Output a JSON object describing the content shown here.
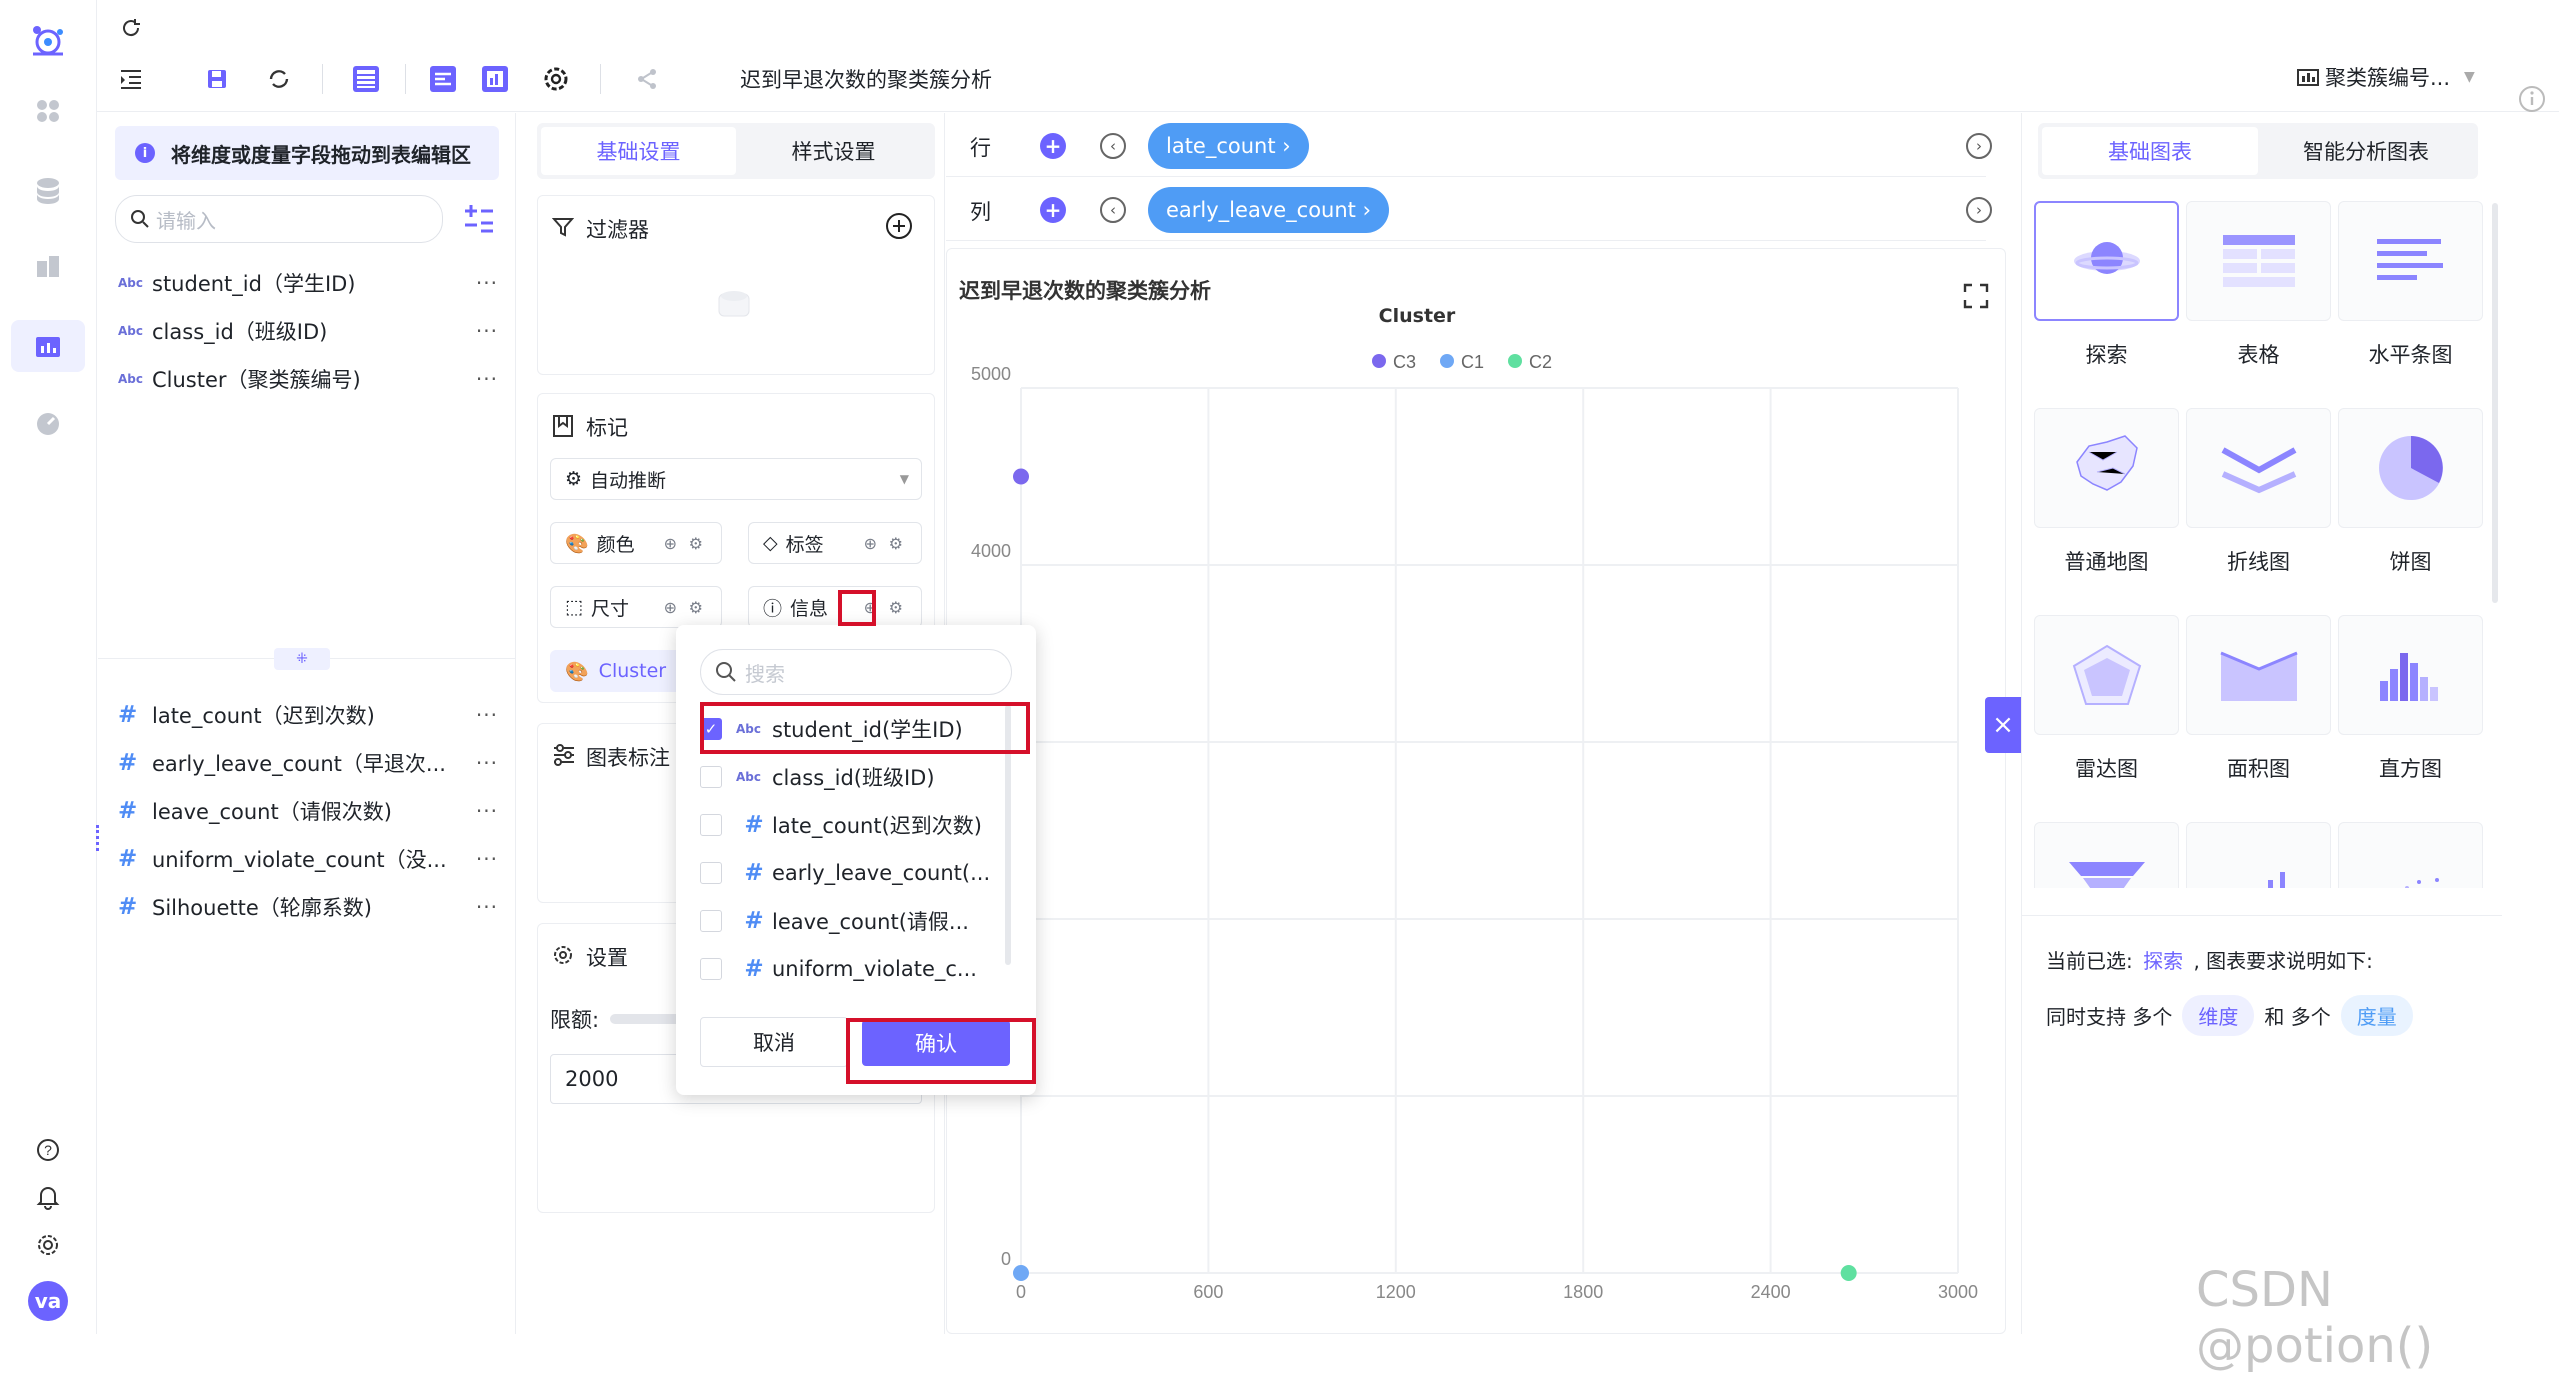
{
  "toolbar": {
    "title": "迟到早退次数的聚类簇分析",
    "right_label": "聚类簇编号..."
  },
  "fields": {
    "hint": "将维度或度量字段拖动到表编辑区",
    "search_placeholder": "请输入",
    "dimensions": [
      {
        "type": "Abc",
        "label": "student_id（学生ID)"
      },
      {
        "type": "Abc",
        "label": "class_id（班级ID)"
      },
      {
        "type": "Abc",
        "label": "Cluster（聚类簇编号)"
      }
    ],
    "measures": [
      {
        "type": "#",
        "label": "late_count（迟到次数)"
      },
      {
        "type": "#",
        "label": "early_leave_count（早退次..."
      },
      {
        "type": "#",
        "label": "leave_count（请假次数)"
      },
      {
        "type": "#",
        "label": "uniform_violate_count（没..."
      },
      {
        "type": "#",
        "label": "Silhouette（轮廓系数)"
      }
    ],
    "more": "···"
  },
  "config": {
    "tab_basic": "基础设置",
    "tab_style": "样式设置",
    "filter_label": "过滤器",
    "marks_label": "标记",
    "auto_infer": "自动推断",
    "color": "颜色",
    "label": "标签",
    "size": "尺寸",
    "info": "信息",
    "cluster_chip": "Cluster",
    "annotation_label": "图表标注",
    "settings_label": "设置",
    "limit_label": "限额:",
    "limit_value": "2000"
  },
  "shelf": {
    "row_label": "行",
    "col_label": "列",
    "row_pill": "late_count ›",
    "col_pill": "early_leave_count ›"
  },
  "chart_data": {
    "type": "scatter",
    "title": "迟到早退次数的聚类簇分析",
    "legend_title": "Cluster",
    "legend_position": "top-center",
    "xlim": [
      0,
      3000
    ],
    "ylim": [
      0,
      5000
    ],
    "x_ticks": [
      0,
      600,
      1200,
      1800,
      2400,
      3000
    ],
    "y_ticks": [
      0,
      1000,
      4000,
      5000
    ],
    "grid": true,
    "series": [
      {
        "name": "C3",
        "color": "#7b68ee",
        "points": [
          [
            0,
            4500
          ]
        ]
      },
      {
        "name": "C1",
        "color": "#6fa8f5",
        "points": [
          [
            0,
            0
          ]
        ]
      },
      {
        "name": "C2",
        "color": "#5fe0a0",
        "points": [
          [
            2650,
            0
          ]
        ]
      }
    ]
  },
  "popup": {
    "search_placeholder": "搜索",
    "items": [
      {
        "type": "Abc",
        "label": "student_id(学生ID)",
        "checked": true
      },
      {
        "type": "Abc",
        "label": "class_id(班级ID)",
        "checked": false
      },
      {
        "type": "#",
        "label": "late_count(迟到次数)",
        "checked": false
      },
      {
        "type": "#",
        "label": "early_leave_count(...",
        "checked": false
      },
      {
        "type": "#",
        "label": "leave_count(请假...",
        "checked": false
      },
      {
        "type": "#",
        "label": "uniform_violate_c...",
        "checked": false
      }
    ],
    "cancel": "取消",
    "confirm": "确认"
  },
  "right": {
    "tab_basic": "基础图表",
    "tab_smart": "智能分析图表",
    "tiles": [
      "探索",
      "表格",
      "水平条图",
      "普通地图",
      "折线图",
      "饼图",
      "雷达图",
      "面积图",
      "直方图"
    ],
    "current_prefix": "当前已选:",
    "current_value": "探索",
    "current_suffix": ", 图表要求说明如下:",
    "support_prefix": "同时支持 多个",
    "dim_badge": "维度",
    "support_mid": "和 多个",
    "measure_badge": "度量"
  },
  "watermark": "CSDN @potion()",
  "avatar": "va",
  "colors": {
    "accent": "#6c63ff",
    "pill": "#4f9cf5",
    "annotation": "#d5102a"
  }
}
